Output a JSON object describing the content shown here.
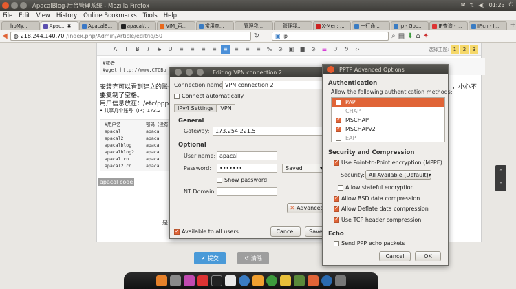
{
  "colors": {
    "accent": "#e06437",
    "panel": "#3d3c38",
    "submit": "#4a9ad8"
  },
  "os": {
    "window_title": "ApacalBlog-后台管理系统 - Mozilla Firefox",
    "time": "01:23",
    "volume": "◀)"
  },
  "menubar": [
    "File",
    "Edit",
    "View",
    "History",
    "Online Bookmarks",
    "Tools",
    "Help"
  ],
  "tabs": [
    {
      "label": "hpMy...",
      "color": "#c9c6bf"
    },
    {
      "label": "Apac...",
      "color": "#5c4fb0"
    },
    {
      "label": "ApacalB...",
      "color": "#3b78c6"
    },
    {
      "label": "apacal/...",
      "color": "#222"
    },
    {
      "label": "VIM_百...",
      "color": "#e8681c"
    },
    {
      "label": "常用查...",
      "color": "#3a7cc3"
    },
    {
      "label": "管理我...",
      "color": "#c9c6bf"
    },
    {
      "label": "管理我...",
      "color": "#c9c6bf"
    },
    {
      "label": "X-Men: ...",
      "color": "#c22"
    },
    {
      "label": "一行命...",
      "color": "#3a7cc3"
    },
    {
      "label": "ip - Goo...",
      "color": "#3a7cc3"
    },
    {
      "label": "IP查询 - ...",
      "color": "#d33"
    },
    {
      "label": "IP.cn - I...",
      "color": "#3a7cc3"
    }
  ],
  "nav": {
    "url_host": "218.244.140.70",
    "url_path": "/index.php/Admin/Article/edit/id/50",
    "search": "ip"
  },
  "editor": {
    "toolbar": [
      "A",
      "T",
      "B",
      "I",
      "S",
      "U",
      "≡",
      "≡",
      "≡",
      "≡",
      "≡",
      "≡",
      "≡",
      "≡",
      "%",
      "⊘",
      "▣",
      "■",
      "⊘",
      "☰",
      "↺",
      "↻",
      "‹›"
    ],
    "theme_label": "选择主题:",
    "theme_nums": [
      "1",
      "2",
      "3"
    ],
    "code_lines": [
      "#或者",
      "#wget http://www.CTOBo"
    ],
    "para1": "安装完可以看到建立的账号",
    "para1_tail": "，小心不",
    "para2": "要复制了空格。",
    "para3": "用户信息放在：/etc/ppp",
    "para4": "• 共享几个账号（IP：173.2",
    "code_header": [
      "#用户名",
      "密码（没有"
    ],
    "code_rows": [
      [
        "apacal",
        "apaca"
      ],
      [
        "apacal2",
        "apaca"
      ],
      [
        "apacalblog",
        "apaca"
      ],
      [
        "apacalblog2",
        "apaca"
      ],
      [
        "apacal.cn",
        "apaca"
      ],
      [
        "apacal2.cn",
        "apaca"
      ]
    ],
    "apacal_code": "apacal code",
    "under_text": "是否"
  },
  "page": {
    "submit": "提交",
    "clear": "清除"
  },
  "vpn_dialog": {
    "title": "Editing VPN connection 2",
    "connection_name_label": "Connection name:",
    "connection_name": "VPN connection 2",
    "connect_auto": "Connect automatically",
    "tab_ipv4": "IPv4 Settings",
    "tab_vpn": "VPN",
    "general": "General",
    "gateway_label": "Gateway:",
    "gateway": "173.254.221.5",
    "optional": "Optional",
    "username_label": "User name:",
    "username": "apacal",
    "password_label": "Password:",
    "password": "•••••••",
    "saved": "Saved",
    "show_password": "Show password",
    "nt_domain_label": "NT Domain:",
    "nt_domain": "",
    "advanced": "Advanced",
    "available_all": "Available to all users",
    "cancel": "Cancel",
    "save": "Save"
  },
  "pptp_dialog": {
    "title": "PPTP Advanced Options",
    "authentication": "Authentication",
    "allow_methods": "Allow the following authentication methods:",
    "methods": [
      {
        "label": "PAP",
        "checked": false,
        "selected": true,
        "dim": false
      },
      {
        "label": "CHAP",
        "checked": false,
        "selected": false,
        "dim": true
      },
      {
        "label": "MSCHAP",
        "checked": true,
        "selected": false,
        "dim": false
      },
      {
        "label": "MSCHAPv2",
        "checked": true,
        "selected": false,
        "dim": false
      },
      {
        "label": "EAP",
        "checked": false,
        "selected": false,
        "dim": true
      }
    ],
    "security_compression": "Security and Compression",
    "use_mppe": "Use Point-to-Point encryption (MPPE)",
    "security_label": "Security:",
    "security_value": "All Available (Default)",
    "stateful": "Allow stateful encryption",
    "bsd": "Allow BSD data compression",
    "deflate": "Allow Deflate data compression",
    "tcp_header": "Use TCP header compression",
    "echo": "Echo",
    "send_echo": "Send PPP echo packets",
    "cancel": "Cancel",
    "ok": "OK"
  }
}
